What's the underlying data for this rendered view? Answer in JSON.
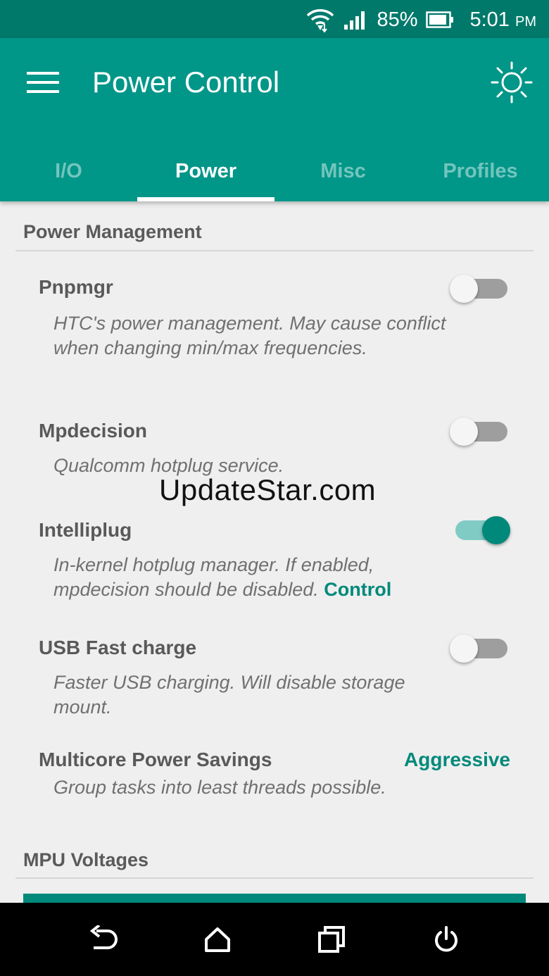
{
  "status_bar": {
    "battery_percent": "85%",
    "time": "5:01",
    "ampm": "PM",
    "icons": [
      "wifi-icon",
      "signal-icon",
      "battery-icon"
    ]
  },
  "app_bar": {
    "title": "Power Control",
    "menu_icon": "hamburger-menu-icon",
    "theme_icon": "brightness-icon"
  },
  "tabs": [
    {
      "label": "I/O",
      "active": false
    },
    {
      "label": "Power",
      "active": true
    },
    {
      "label": "Misc",
      "active": false
    },
    {
      "label": "Profiles",
      "active": false
    }
  ],
  "sections": {
    "power_management": "Power Management",
    "mpu_voltages": "MPU Voltages"
  },
  "prefs": [
    {
      "title": "Pnpmgr",
      "summary": "HTC's power management. May cause conflict when changing min/max frequencies.",
      "enabled": false
    },
    {
      "title": "Mpdecision",
      "summary": "Qualcomm hotplug service.",
      "enabled": false
    },
    {
      "title": "Intelliplug",
      "summary": "In-kernel hotplug manager. If enabled, mpdecision should be disabled.",
      "summary_link": "Control",
      "enabled": true
    },
    {
      "title": "USB Fast charge",
      "summary": "Faster USB charging. Will disable storage mount.",
      "enabled": false
    },
    {
      "title": "Multicore Power Savings",
      "summary": "Group tasks into least threads possible.",
      "value": "Aggressive"
    }
  ],
  "watermark": "UpdateStar.com",
  "nav_bar": [
    "back-icon",
    "home-icon",
    "recents-icon",
    "power-icon"
  ],
  "colors": {
    "primary": "#009688",
    "primary_dark": "#00796b",
    "accent": "#00897b",
    "background": "#efefef"
  }
}
